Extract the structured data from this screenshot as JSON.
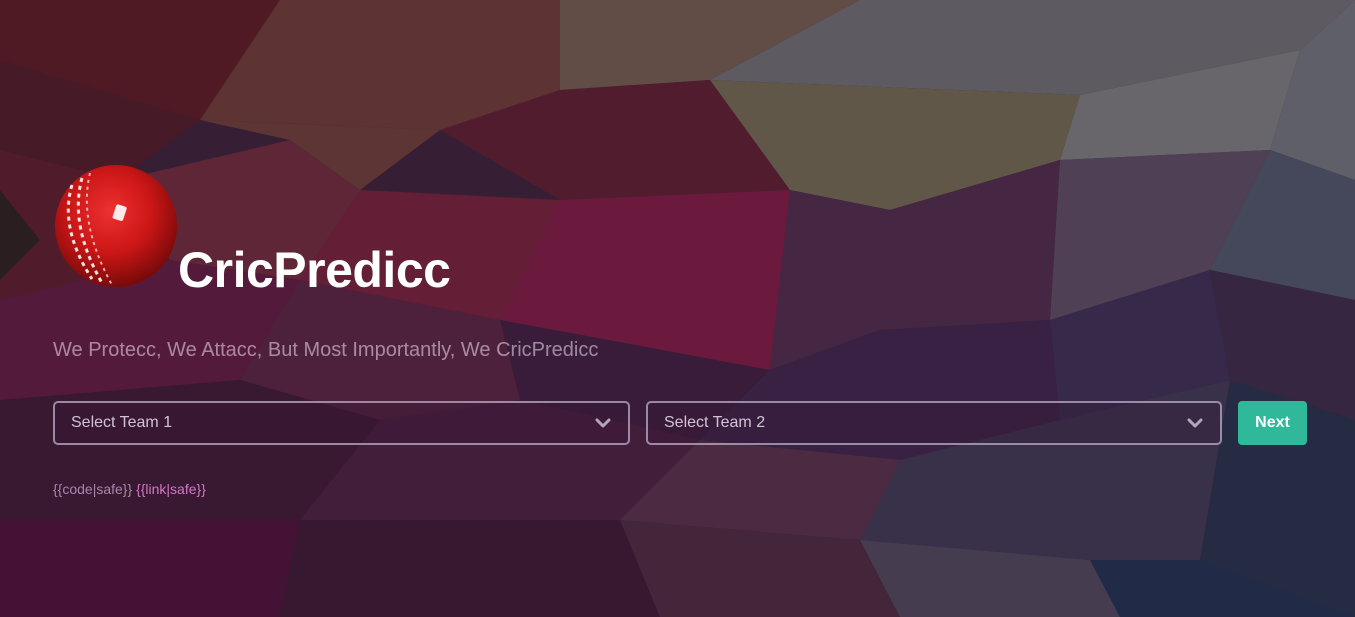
{
  "app": {
    "title": "CricPredicc",
    "tagline": "We Protecc, We Attacc, But Most Importantly, We CricPredicc"
  },
  "form": {
    "team1": {
      "selected": "Select Team 1"
    },
    "team2": {
      "selected": "Select Team 2"
    },
    "next_label": "Next"
  },
  "footer": {
    "code": "{{code|safe}}",
    "link": "{{link|safe}}"
  },
  "icons": {
    "logo": "cricket-ball-icon",
    "dropdown": "chevron-down-icon"
  },
  "colors": {
    "accent": "#2fb99a",
    "title": "#ffffff",
    "ball": "#d01818"
  }
}
